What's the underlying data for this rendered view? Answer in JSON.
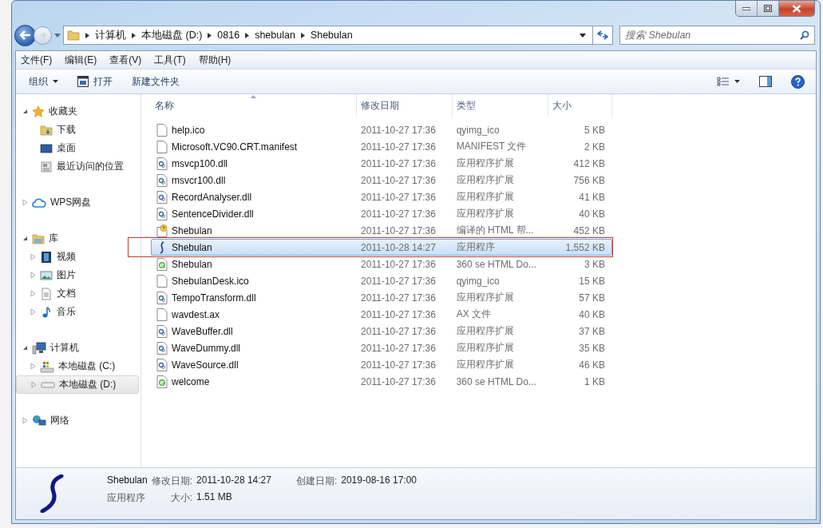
{
  "address": {
    "segments": [
      "计算机",
      "本地磁盘 (D:)",
      "0816",
      "shebulan",
      "Shebulan"
    ]
  },
  "search": {
    "placeholder": "搜索 Shebulan"
  },
  "menu": [
    "文件(F)",
    "编辑(E)",
    "查看(V)",
    "工具(T)",
    "帮助(H)"
  ],
  "toolbar": [
    {
      "label": "组织",
      "kind": "dropdown"
    },
    {
      "label": "打开",
      "kind": "icon"
    },
    {
      "label": "新建文件夹",
      "kind": "plain"
    }
  ],
  "sidebar": [
    {
      "label": "收藏夹",
      "kind": "favorites",
      "expanded": true,
      "selected": false,
      "children": [
        {
          "label": "下载",
          "kind": "downloads",
          "selected": false
        },
        {
          "label": "桌面",
          "kind": "desktop",
          "selected": false
        },
        {
          "label": "最近访问的位置",
          "kind": "recent",
          "selected": false
        }
      ]
    },
    {
      "label": "WPS网盘",
      "kind": "cloud",
      "expanded": false,
      "selected": false
    },
    {
      "label": "库",
      "kind": "library",
      "expanded": true,
      "selected": false,
      "children": [
        {
          "label": "视频",
          "kind": "video",
          "expanded": false,
          "selected": false
        },
        {
          "label": "图片",
          "kind": "pictures",
          "expanded": false,
          "selected": false
        },
        {
          "label": "文档",
          "kind": "documents",
          "expanded": false,
          "selected": false
        },
        {
          "label": "音乐",
          "kind": "music",
          "expanded": false,
          "selected": false
        }
      ]
    },
    {
      "label": "计算机",
      "kind": "computer",
      "expanded": true,
      "selected": false,
      "children": [
        {
          "label": "本地磁盘 (C:)",
          "kind": "system-drive",
          "expanded": false,
          "selected": false
        },
        {
          "label": "本地磁盘 (D:)",
          "kind": "drive",
          "expanded": false,
          "selected": true
        }
      ]
    },
    {
      "label": "网络",
      "kind": "network",
      "expanded": false,
      "selected": false
    }
  ],
  "table": {
    "columns": [
      {
        "label": "名称",
        "sorted": true
      },
      {
        "label": "修改日期",
        "sorted": false
      },
      {
        "label": "类型",
        "sorted": false
      },
      {
        "label": "大小",
        "sorted": false
      }
    ],
    "rows": [
      {
        "name": "help.ico",
        "date": "2011-10-27 17:36",
        "type": "qyimg_ico",
        "size": "5 KB",
        "kind": "file",
        "selected": false,
        "outlined": false
      },
      {
        "name": "Microsoft.VC90.CRT.manifest",
        "date": "2011-10-27 17:36",
        "type": "MANIFEST 文件",
        "size": "2 KB",
        "kind": "file",
        "selected": false,
        "outlined": false
      },
      {
        "name": "msvcp100.dll",
        "date": "2011-10-27 17:36",
        "type": "应用程序扩展",
        "size": "412 KB",
        "kind": "dll",
        "selected": false,
        "outlined": false
      },
      {
        "name": "msvcr100.dll",
        "date": "2011-10-27 17:36",
        "type": "应用程序扩展",
        "size": "756 KB",
        "kind": "dll",
        "selected": false,
        "outlined": false
      },
      {
        "name": "RecordAnalyser.dll",
        "date": "2011-10-27 17:36",
        "type": "应用程序扩展",
        "size": "41 KB",
        "kind": "dll",
        "selected": false,
        "outlined": false
      },
      {
        "name": "SentenceDivider.dll",
        "date": "2011-10-27 17:36",
        "type": "应用程序扩展",
        "size": "40 KB",
        "kind": "dll",
        "selected": false,
        "outlined": false
      },
      {
        "name": "Shebulan",
        "date": "2011-10-27 17:36",
        "type": "编译的 HTML 帮...",
        "size": "452 KB",
        "kind": "help",
        "selected": false,
        "outlined": false
      },
      {
        "name": "Shebulan",
        "date": "2011-10-28 14:27",
        "type": "应用程序",
        "size": "1,552 KB",
        "kind": "app",
        "selected": true,
        "outlined": true
      },
      {
        "name": "Shebulan",
        "date": "2011-10-27 17:36",
        "type": "360 se HTML Do...",
        "size": "3 KB",
        "kind": "web",
        "selected": false,
        "outlined": false
      },
      {
        "name": "ShebulanDesk.ico",
        "date": "2011-10-27 17:36",
        "type": "qyimg_ico",
        "size": "15 KB",
        "kind": "file",
        "selected": false,
        "outlined": false
      },
      {
        "name": "TempoTransform.dll",
        "date": "2011-10-27 17:36",
        "type": "应用程序扩展",
        "size": "57 KB",
        "kind": "dll",
        "selected": false,
        "outlined": false
      },
      {
        "name": "wavdest.ax",
        "date": "2011-10-27 17:36",
        "type": "AX 文件",
        "size": "40 KB",
        "kind": "file",
        "selected": false,
        "outlined": false
      },
      {
        "name": "WaveBuffer.dll",
        "date": "2011-10-27 17:36",
        "type": "应用程序扩展",
        "size": "37 KB",
        "kind": "dll",
        "selected": false,
        "outlined": false
      },
      {
        "name": "WaveDummy.dll",
        "date": "2011-10-27 17:36",
        "type": "应用程序扩展",
        "size": "35 KB",
        "kind": "dll",
        "selected": false,
        "outlined": false
      },
      {
        "name": "WaveSource.dll",
        "date": "2011-10-27 17:36",
        "type": "应用程序扩展",
        "size": "46 KB",
        "kind": "dll",
        "selected": false,
        "outlined": false
      },
      {
        "name": "welcome",
        "date": "2011-10-27 17:36",
        "type": "360 se HTML Do...",
        "size": "1 KB",
        "kind": "web",
        "selected": false,
        "outlined": false
      }
    ]
  },
  "details": {
    "name": "Shebulan",
    "type": "应用程序",
    "fields": [
      {
        "label": "修改日期:",
        "value": "2011-10-28 14:27"
      },
      {
        "label": "创建日期:",
        "value": "2019-08-16 17:00"
      },
      {
        "label": "大小:",
        "value": "1.51 MB"
      }
    ]
  }
}
